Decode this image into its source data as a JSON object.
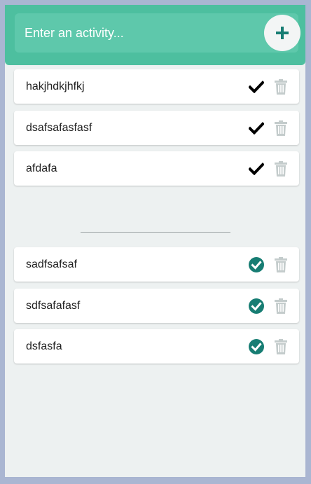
{
  "header": {
    "input_placeholder": "Enter an activity...",
    "add_icon": "plus-icon",
    "accent_color": "#4dbf9f"
  },
  "todo": {
    "items": [
      {
        "text": "hakjhdkjhfkj",
        "complete_icon": "checkmark-icon",
        "delete_icon": "trash-icon"
      },
      {
        "text": "dsafsafasfasf",
        "complete_icon": "checkmark-icon",
        "delete_icon": "trash-icon"
      },
      {
        "text": "afdafa",
        "complete_icon": "checkmark-icon",
        "delete_icon": "trash-icon"
      }
    ]
  },
  "completed": {
    "items": [
      {
        "text": "sadfsafsaf",
        "complete_icon": "check-circle-icon",
        "delete_icon": "trash-icon"
      },
      {
        "text": "sdfsafafasf",
        "complete_icon": "check-circle-icon",
        "delete_icon": "trash-icon"
      },
      {
        "text": "dsfasfa",
        "complete_icon": "check-circle-icon",
        "delete_icon": "trash-icon"
      }
    ]
  },
  "colors": {
    "completed_check": "#177d73",
    "trash": "#c4cccc",
    "background": "#edf1f1"
  }
}
